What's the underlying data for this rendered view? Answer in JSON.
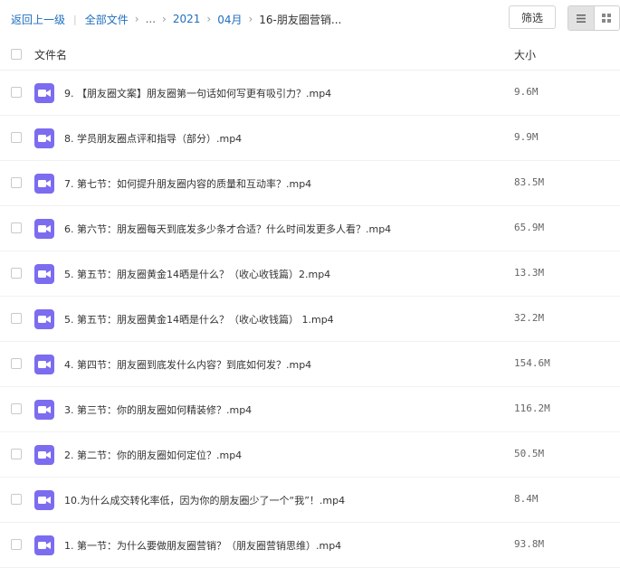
{
  "breadcrumb": {
    "back": "返回上一级",
    "all_files": "全部文件",
    "ellipsis": "...",
    "year": "2021",
    "month": "04月",
    "current": "16-朋友圈营销..."
  },
  "toolbar": {
    "filter_label": "筛选",
    "view_list_icon": "list-view-icon",
    "view_grid_icon": "grid-view-icon"
  },
  "table": {
    "col_name": "文件名",
    "col_size": "大小"
  },
  "colors": {
    "link": "#1f6fbf",
    "video_icon": "#7b6cf0"
  },
  "files": [
    {
      "name": "9. 【朋友圈文案】朋友圈第一句话如何写更有吸引力？.mp4",
      "size": "9.6M",
      "icon": "video-file-icon"
    },
    {
      "name": "8. 学员朋友圈点评和指导（部分）.mp4",
      "size": "9.9M",
      "icon": "video-file-icon"
    },
    {
      "name": "7. 第七节：如何提升朋友圈内容的质量和互动率？.mp4",
      "size": "83.5M",
      "icon": "video-file-icon"
    },
    {
      "name": "6. 第六节：朋友圈每天到底发多少条才合适？什么时间发更多人看？.mp4",
      "size": "65.9M",
      "icon": "video-file-icon"
    },
    {
      "name": "5. 第五节：朋友圈黄金14晒是什么？（收心收钱篇）2.mp4",
      "size": "13.3M",
      "icon": "video-file-icon"
    },
    {
      "name": "5. 第五节：朋友圈黄金14晒是什么？（收心收钱篇） 1.mp4",
      "size": "32.2M",
      "icon": "video-file-icon"
    },
    {
      "name": "4. 第四节：朋友圈到底发什么内容？到底如何发？.mp4",
      "size": "154.6M",
      "icon": "video-file-icon"
    },
    {
      "name": "3. 第三节：你的朋友圈如何精装修？.mp4",
      "size": "116.2M",
      "icon": "video-file-icon"
    },
    {
      "name": "2. 第二节：你的朋友圈如何定位？.mp4",
      "size": "50.5M",
      "icon": "video-file-icon"
    },
    {
      "name": "10.为什么成交转化率低，因为你的朋友圈少了一个“我”！.mp4",
      "size": "8.4M",
      "icon": "video-file-icon"
    },
    {
      "name": "1. 第一节：为什么要做朋友圈营销？（朋友圈营销思维）.mp4",
      "size": "93.8M",
      "icon": "video-file-icon"
    }
  ]
}
